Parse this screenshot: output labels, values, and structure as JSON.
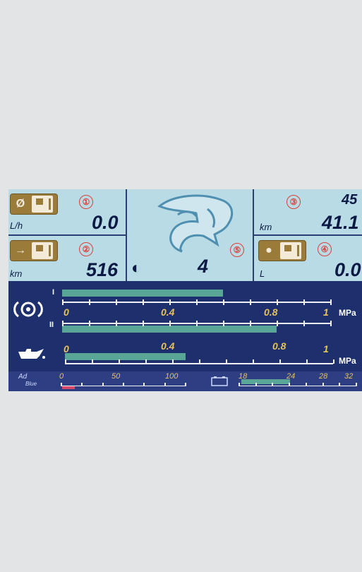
{
  "top": {
    "fuel_rate": {
      "badge_symbol": "Ø",
      "marker": "①",
      "unit": "L/h",
      "value": "0.0"
    },
    "range": {
      "badge_symbol": "→",
      "marker": "②",
      "unit": "km",
      "value": "516"
    },
    "trip": {
      "marker": "③",
      "value_top": "45",
      "unit": "km",
      "value": "41.1"
    },
    "fuel_used": {
      "badge_symbol": "●",
      "marker": "④",
      "unit": "L",
      "value": "0.0"
    },
    "center": {
      "marker": "⑤",
      "mode_symbol": "◐",
      "value": "4"
    }
  },
  "brake_pressure": {
    "scale_labels": [
      "0",
      "0.4",
      "0.8",
      "1"
    ],
    "unit": "MPa",
    "circuit_1_label": "I",
    "circuit_2_label": "II",
    "circuit_1_value": 0.6,
    "circuit_2_value": 0.8
  },
  "oil_pressure": {
    "scale_labels": [
      "0",
      "0.4",
      "0.8",
      "1"
    ],
    "unit": "MPa",
    "value": 0.45
  },
  "adblue": {
    "label_top": "Ad",
    "label_bottom": "Blue",
    "scale_labels": [
      "0",
      "50",
      "100"
    ],
    "value": 0
  },
  "battery": {
    "scale_labels": [
      "18",
      "24",
      "28",
      "32"
    ],
    "value": 24
  },
  "colors": {
    "panel": "#b9dbe6",
    "screen": "#1e2f6e",
    "bar": "#5aa696",
    "scale_text": "#e6c25a",
    "badge": "#9b7b3a",
    "marker": "#d9413a"
  }
}
